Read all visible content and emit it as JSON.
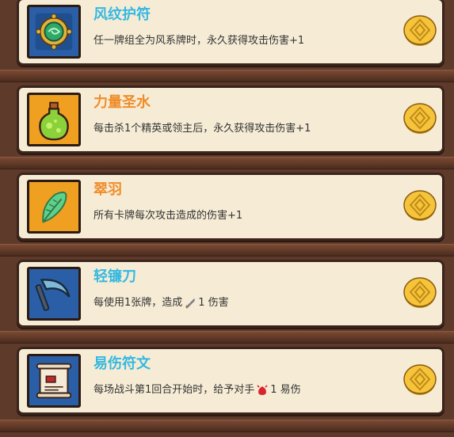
{
  "relics": [
    {
      "name": "风纹护符",
      "title_color": "#36b8e0",
      "icon": "wind-amulet-icon",
      "icon_bg": "#2a5fa8",
      "description": "任一牌组全为风系牌时，永久获得攻击伤害+1"
    },
    {
      "name": "力量圣水",
      "title_color": "#ef8d2a",
      "icon": "strength-potion-icon",
      "icon_bg": "#f0a020",
      "description": "每击杀1个精英或领主后，永久获得攻击伤害+1"
    },
    {
      "name": "翠羽",
      "title_color": "#ef8d2a",
      "icon": "green-feather-icon",
      "icon_bg": "#f0a020",
      "description": "所有卡牌每次攻击造成的伤害+1"
    },
    {
      "name": "轻镰刀",
      "title_color": "#36b8e0",
      "icon": "light-sickle-icon",
      "icon_bg": "#2a5fa8",
      "description_pre": "每使用1张牌，造成",
      "description_post": "1 伤害",
      "inline_icon": "sword-icon"
    },
    {
      "name": "易伤符文",
      "title_color": "#36b8e0",
      "icon": "scroll-rune-icon",
      "icon_bg": "#2a5fa8",
      "description_pre": "每场战斗第1回合开始时，给予对手",
      "description_post": "1 易伤",
      "inline_icon": "vulnerable-icon"
    }
  ],
  "coin_icon": "gold-coin-icon"
}
